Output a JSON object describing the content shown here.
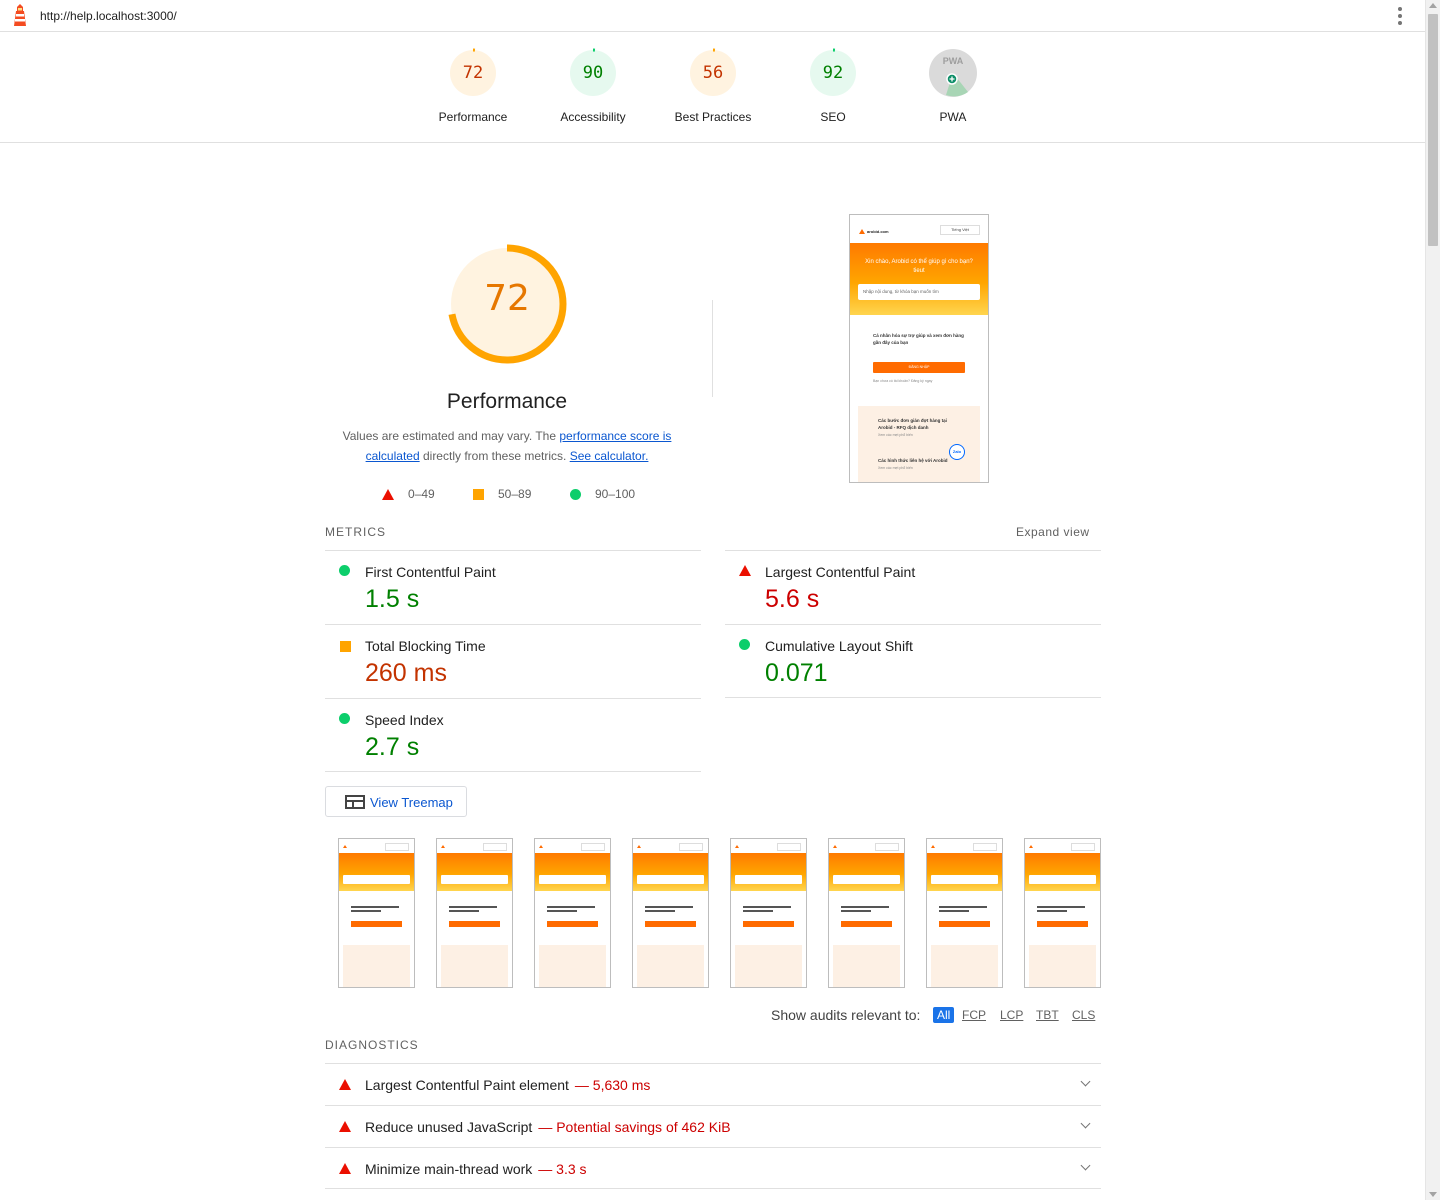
{
  "topbar": {
    "url": "http://help.localhost:3000/"
  },
  "colors": {
    "pass": "#0cce6b",
    "average": "#ffa400",
    "fail": "#eb0f00",
    "link": "#0b57d0"
  },
  "categories": [
    {
      "label": "Performance",
      "score": "72",
      "color": "#c33300",
      "fill": "#fff3e0",
      "arc": "#ffa400"
    },
    {
      "label": "Accessibility",
      "score": "90",
      "color": "#008000",
      "fill": "#e6f9ef",
      "arc": "#0cce6b"
    },
    {
      "label": "Best Practices",
      "score": "56",
      "color": "#c33300",
      "fill": "#fff3e0",
      "arc": "#ffa400"
    },
    {
      "label": "SEO",
      "score": "92",
      "color": "#008000",
      "fill": "#e6f9ef",
      "arc": "#0cce6b"
    },
    {
      "label": "PWA",
      "score": "",
      "badge": "PWA"
    }
  ],
  "performance": {
    "score": "72",
    "title": "Performance",
    "desc_1": "Values are estimated and may vary. The ",
    "link_1": "performance score is calculated",
    "desc_2": " directly from these metrics. ",
    "link_2": "See calculator.",
    "legend": [
      "0–49",
      "50–89",
      "90–100"
    ]
  },
  "screenshot": {
    "logo": "arobid.com",
    "lang": "Tiếng Việt",
    "hero": "Xin chào, Arobid có thể giúp gì cho bạn?",
    "hero_2": "tieut",
    "search_placeholder": "Nhập nội dung, từ khóa bạn muốn tìm",
    "body_text": "Cá nhân hóa sự trợ giúp và xem đơn hàng gần đây của bạn",
    "button": "ĐĂNG NHẬP",
    "small": "Bạn chưa có tài khoản? Đăng ký ngay",
    "card_1": "Các bước đơn giản đợt hàng tại Arobid - RFQ dịch danh",
    "card_1_sub": "Xem các mẹt phổ biến",
    "card_2": "Các hình thức liên hệ với Arobid",
    "card_2_sub": "Xem các mẹt phổ biến",
    "zalo": "Zalo"
  },
  "metrics": {
    "title": "METRICS",
    "expand": "Expand view",
    "items": [
      {
        "label": "First Contentful Paint",
        "value": "1.5 s",
        "status": "pass"
      },
      {
        "label": "Largest Contentful Paint",
        "value": "5.6 s",
        "status": "fail"
      },
      {
        "label": "Total Blocking Time",
        "value": "260 ms",
        "status": "average"
      },
      {
        "label": "Cumulative Layout Shift",
        "value": "0.071",
        "status": "pass"
      },
      {
        "label": "Speed Index",
        "value": "2.7 s",
        "status": "pass"
      }
    ]
  },
  "treemap": {
    "label": "View Treemap"
  },
  "filter": {
    "label": "Show audits relevant to:",
    "chips": [
      "All",
      "FCP",
      "LCP",
      "TBT",
      "CLS"
    ]
  },
  "diagnostics": {
    "title": "DIAGNOSTICS",
    "items": [
      {
        "label": "Largest Contentful Paint element",
        "value": "— 5,630 ms"
      },
      {
        "label": "Reduce unused JavaScript",
        "value": "— Potential savings of 462 KiB"
      },
      {
        "label": "Minimize main-thread work",
        "value": "— 3.3 s"
      }
    ]
  }
}
